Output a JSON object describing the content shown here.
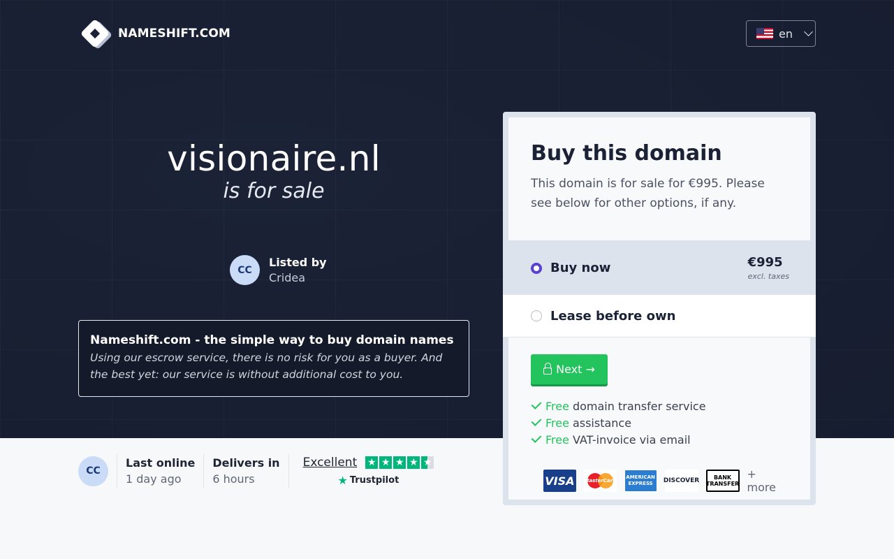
{
  "brand": {
    "name": "NAMESHIFT.COM"
  },
  "language": {
    "code": "en"
  },
  "domain": {
    "name": "visionaire.nl",
    "tagline": "is for sale"
  },
  "seller": {
    "initials": "CC",
    "listed_label": "Listed by",
    "name": "Cridea"
  },
  "info": {
    "heading": "Nameshift.com - the simple way to buy domain names",
    "text": "Using our escrow service, there is no risk for you as a buyer. And the best yet: our service is without additional cost to you."
  },
  "stats": {
    "last_online_label": "Last online",
    "last_online_value": "1 day ago",
    "delivers_label": "Delivers in",
    "delivers_value": "6 hours",
    "trust_word": "Excellent",
    "trustpilot": "Trustpilot",
    "rating": 4.5
  },
  "buy_card": {
    "title": "Buy this domain",
    "description": "This domain is for sale for €995. Please see below for other options, if any.",
    "options": [
      {
        "label": "Buy now",
        "price": "€995",
        "note": "excl. taxes",
        "selected": true
      },
      {
        "label": "Lease before own",
        "selected": false
      }
    ],
    "next_label": "Next →",
    "features": [
      {
        "free": "Free",
        "text": "domain transfer service"
      },
      {
        "free": "Free",
        "text": "assistance"
      },
      {
        "free": "Free",
        "text": "VAT-invoice via email"
      }
    ],
    "payments": {
      "visa": "VISA",
      "mastercard": "MasterCard",
      "amex": "AMERICAN EXPRESS",
      "discover": "DISCOVER",
      "bank": "BANK TRANSFER",
      "more": "+ more"
    }
  },
  "colors": {
    "accent_green": "#23c45e",
    "radio_purple": "#5b3fd6",
    "hero_bg": "#1b2236"
  }
}
